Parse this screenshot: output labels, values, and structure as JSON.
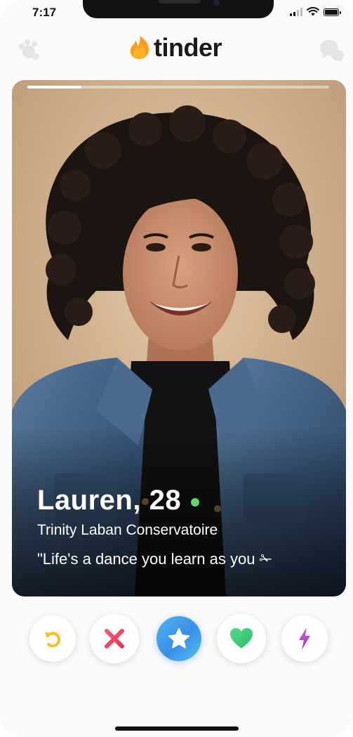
{
  "status_bar": {
    "time": "7:17"
  },
  "header": {
    "logo_text": "tinder",
    "left_icon": "boost-paw-icon",
    "right_icon": "chat-bubbles-icon"
  },
  "profile": {
    "name_age": "Lauren, 28",
    "online": true,
    "school": "Trinity Laban Conservatoire",
    "bio": "\"Life's a dance you learn as you ✁",
    "photo_count_indicator": {
      "current": 1,
      "progress_fraction": 0.18
    }
  },
  "actions": [
    {
      "name": "rewind-button",
      "icon": "rewind-icon",
      "color": "#f6c026"
    },
    {
      "name": "nope-button",
      "icon": "x-icon",
      "color": "#f0455d"
    },
    {
      "name": "super-like-button",
      "icon": "star-icon",
      "color": "#3c9be8"
    },
    {
      "name": "like-button",
      "icon": "heart-icon",
      "color": "#43cd7a"
    },
    {
      "name": "boost-button",
      "icon": "lightning-icon",
      "color": "#b84cd6"
    }
  ],
  "colors": {
    "brand": "#fe7f1e",
    "online": "#63d36b"
  }
}
